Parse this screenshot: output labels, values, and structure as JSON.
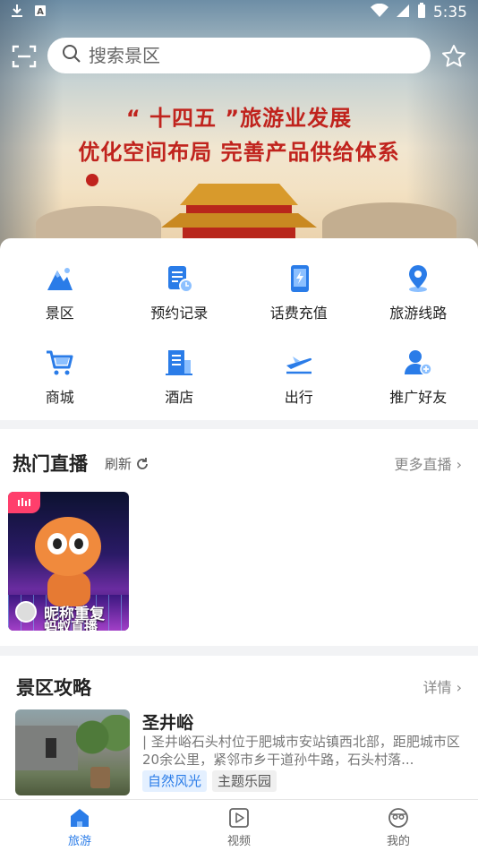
{
  "status_bar": {
    "time": "5:35"
  },
  "search": {
    "placeholder": "搜索景区"
  },
  "banner": {
    "line1": "“ 十四五 ”旅游业发展",
    "line2": "优化空间布局  完善产品供给体系"
  },
  "shortcuts": [
    {
      "label": "景区",
      "icon": "mountain-icon"
    },
    {
      "label": "预约记录",
      "icon": "booking-record-icon"
    },
    {
      "label": "话费充值",
      "icon": "phone-recharge-icon"
    },
    {
      "label": "旅游线路",
      "icon": "location-pin-icon"
    },
    {
      "label": "商城",
      "icon": "cart-icon"
    },
    {
      "label": "酒店",
      "icon": "hotel-icon"
    },
    {
      "label": "出行",
      "icon": "airplane-icon"
    },
    {
      "label": "推广好友",
      "icon": "add-friend-icon"
    }
  ],
  "live": {
    "title": "热门直播",
    "refresh_label": "刷新",
    "more_label": "更多直播 ›",
    "card": {
      "nickname": "昵称重复",
      "caption": "蚂蚁直播"
    }
  },
  "guide": {
    "title": "景区攻略",
    "detail_label": "详情 ›",
    "item": {
      "name": "圣井峪",
      "description": "| 圣井峪石头村位于肥城市安站镇西北部，距肥城市区20余公里，紧邻市乡干道孙牛路，石头村落...",
      "tags": [
        "自然风光",
        "主题乐园"
      ]
    }
  },
  "bottom_nav": [
    {
      "label": "旅游",
      "active": true
    },
    {
      "label": "视频",
      "active": false
    },
    {
      "label": "我的",
      "active": false
    }
  ],
  "colors": {
    "accent": "#2a7ce8",
    "banner_text": "#c0231d",
    "live_badge": "#ff3f6c"
  }
}
